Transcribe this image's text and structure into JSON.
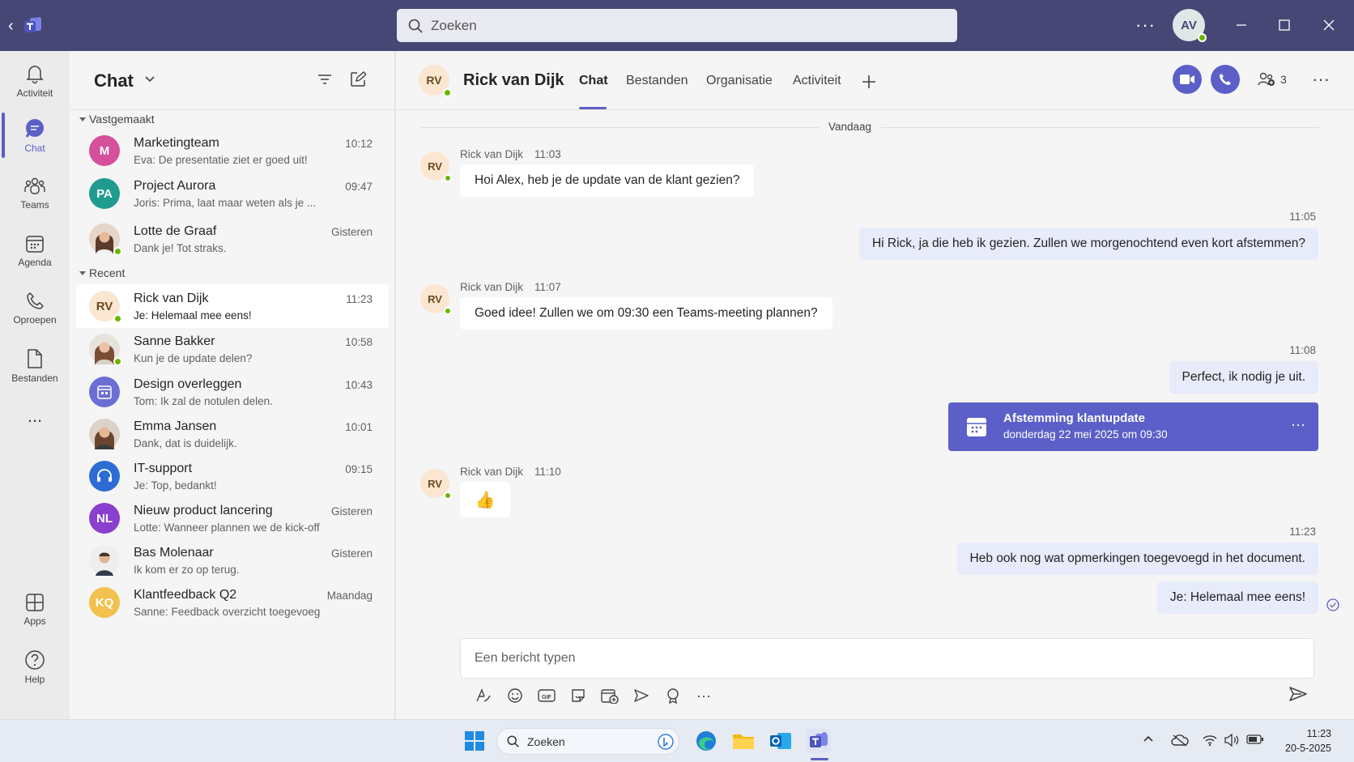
{
  "titlebar": {
    "search_placeholder": "Zoeken",
    "user_initials": "AV"
  },
  "rail": {
    "items": [
      {
        "label": "Activiteit",
        "icon": "bell-icon"
      },
      {
        "label": "Chat",
        "icon": "chat-icon"
      },
      {
        "label": "Teams",
        "icon": "teams-icon"
      },
      {
        "label": "Agenda",
        "icon": "calendar-icon"
      },
      {
        "label": "Oproepen",
        "icon": "phone-icon"
      },
      {
        "label": "Bestanden",
        "icon": "file-icon"
      },
      {
        "label": "Apps",
        "icon": "apps-icon"
      },
      {
        "label": "Help",
        "icon": "help-icon"
      }
    ],
    "more": "..."
  },
  "chatlist": {
    "title": "Chat",
    "sections": {
      "pinned": "Vastgemaakt",
      "recent": "Recent"
    },
    "pinned": [
      {
        "initials": "M",
        "color": "#d64f9a",
        "name": "Marketingteam",
        "preview": "Eva: De presentatie ziet er goed uit!",
        "time": "10:12"
      },
      {
        "initials": "PA",
        "color": "#1f9c8f",
        "name": "Project Aurora",
        "preview": "Joris: Prima, laat maar weten als je ...",
        "time": "09:47"
      },
      {
        "initials": "",
        "color": "#8a5a44",
        "name": "Lotte de Graaf",
        "preview": "Dank je! Tot straks.",
        "time": "Gisteren"
      }
    ],
    "recent": [
      {
        "initials": "RV",
        "color": "#fbe6d2",
        "name": "Rick van Dijk",
        "preview": "Je: Helemaal mee eens!",
        "time": "11:23"
      },
      {
        "initials": "",
        "color": "#9a6b52",
        "name": "Sanne Bakker",
        "preview": "Kun je de update delen?",
        "time": "10:58"
      },
      {
        "initials": "",
        "color": "#6b6fd4",
        "name": "Design overleggen",
        "preview": "Tom: Ik zal de notulen delen.",
        "time": "10:43"
      },
      {
        "initials": "",
        "color": "#7a5040",
        "name": "Emma Jansen",
        "preview": "Dank, dat is duidelijk.",
        "time": "10:01"
      },
      {
        "initials": "",
        "color": "#2c6cd4",
        "name": "IT-support",
        "preview": "Je: Top, bedankt!",
        "time": "09:15"
      },
      {
        "initials": "NL",
        "color": "#8a3fcf",
        "name": "Nieuw product lancering",
        "preview": "Lotte: Wanneer plannen we de kick-off?",
        "time": "Gisteren"
      },
      {
        "initials": "",
        "color": "#a07a66",
        "name": "Bas Molenaar",
        "preview": "Ik kom er zo op terug.",
        "time": "Gisteren"
      },
      {
        "initials": "KQ",
        "color": "#f2c14e",
        "name": "Klantfeedback Q2",
        "preview": "Sanne: Feedback overzicht toegevoegd.",
        "time": "Maandag"
      }
    ]
  },
  "conversation": {
    "initials": "RV",
    "name": "Rick van Dijk",
    "tabs": [
      "Chat",
      "Bestanden",
      "Organisatie",
      "Activiteit"
    ],
    "participants": "3",
    "day": "Vandaag",
    "messages": [
      {
        "author": "Rick van Dijk",
        "time": "11:03",
        "text": "Hoi Alex, heb je de update van de klant gezien?"
      },
      {
        "time": "11:05",
        "text": "Hi Rick, ja die heb ik gezien. Zullen we morgenochtend even kort afstemmen?"
      },
      {
        "author": "Rick van Dijk",
        "time": "11:07",
        "text": "Goed idee! Zullen we om 09:30 een Teams-meeting plannen?"
      },
      {
        "time": "11:08",
        "text": "Perfect, ik nodig je uit."
      },
      {
        "author": "Rick van Dijk",
        "time": "11:10",
        "text": "👍"
      },
      {
        "time": "11:23",
        "text": "Heb ook nog wat opmerkingen toegevoegd in het document."
      },
      {
        "text": "Je: Helemaal mee eens!"
      }
    ],
    "meeting": {
      "title": "Afstemming klantupdate",
      "subtitle": "donderdag 22 mei 2025 om 09:30"
    },
    "compose_placeholder": "Een bericht typen"
  },
  "taskbar": {
    "search_placeholder": "Zoeken",
    "time": "11:23",
    "date": "20-5-2025"
  }
}
